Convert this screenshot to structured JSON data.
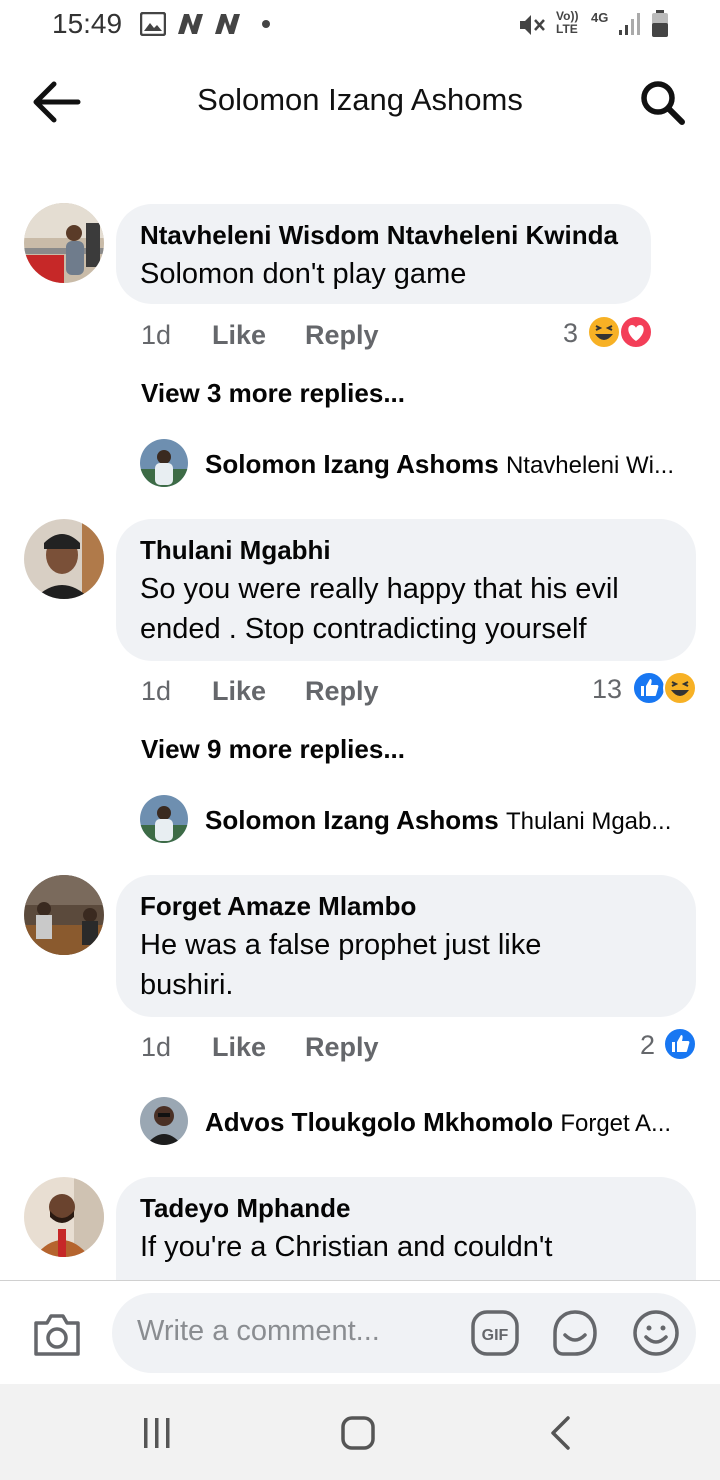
{
  "status": {
    "time": "15:49",
    "network_volte": "Vo)) LTE",
    "network_gen": "4G"
  },
  "header": {
    "title": "Solomon Izang Ashoms"
  },
  "comments": [
    {
      "name": "Ntavheleni Wisdom Ntavheleni Kwinda",
      "text": "Solomon don't play game",
      "time": "1d",
      "like": "Like",
      "reply": "Reply",
      "reactions_count": "3",
      "more_replies": "View 3 more replies...",
      "latest_reply": {
        "name": "Solomon Izang Ashoms",
        "snippet": "Ntavheleni Wi..."
      }
    },
    {
      "name": "Thulani Mgabhi",
      "text_line1": "So you were really happy that his evil",
      "text_line2": "ended . Stop contradicting yourself",
      "time": "1d",
      "like": "Like",
      "reply": "Reply",
      "reactions_count": "13",
      "more_replies": "View 9 more replies...",
      "latest_reply": {
        "name": "Solomon Izang Ashoms",
        "snippet": "Thulani Mgab..."
      }
    },
    {
      "name": "Forget Amaze Mlambo",
      "text_line1": "He was a false prophet just like",
      "text_line2": "bushiri.",
      "time": "1d",
      "like": "Like",
      "reply": "Reply",
      "reactions_count": "2",
      "latest_reply": {
        "name": "Advos Tloukgolo Mkhomolo",
        "snippet": "Forget A..."
      }
    },
    {
      "name": "Tadeyo Mphande",
      "text_line1": "If you're a Christian and couldn't"
    }
  ],
  "composer": {
    "placeholder": "Write a comment..."
  },
  "colors": {
    "bubble": "#f0f2f5",
    "like_blue": "#1877f2",
    "haha_yellow": "#f7b125",
    "love_red": "#f33e58",
    "meta_gray": "#65676b"
  }
}
